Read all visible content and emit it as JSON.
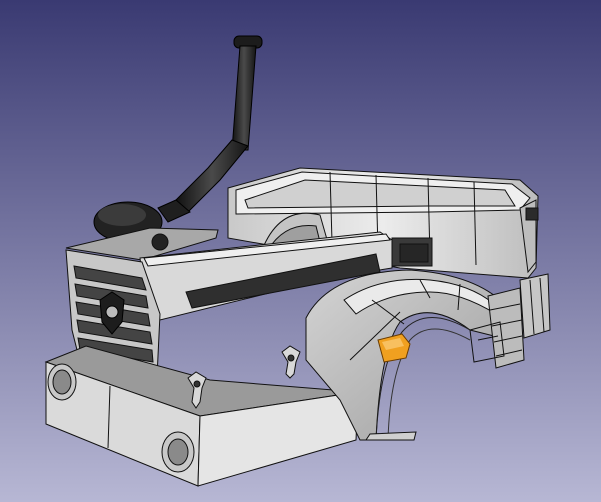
{
  "viewport": {
    "background_top": "#3a3a72",
    "background_bottom": "#b7b7d4"
  },
  "model": {
    "body_color": "#d6d6d6",
    "shadow_color": "#a9a9a9",
    "edge_color": "#111111",
    "dark_part_color": "#2b2b2b",
    "indicator_color": "#f0a020",
    "icons": [
      "exhaust-stack",
      "air-cleaner",
      "grille-emblem",
      "marker-light",
      "tie-down-hook",
      "step-ladder"
    ]
  }
}
